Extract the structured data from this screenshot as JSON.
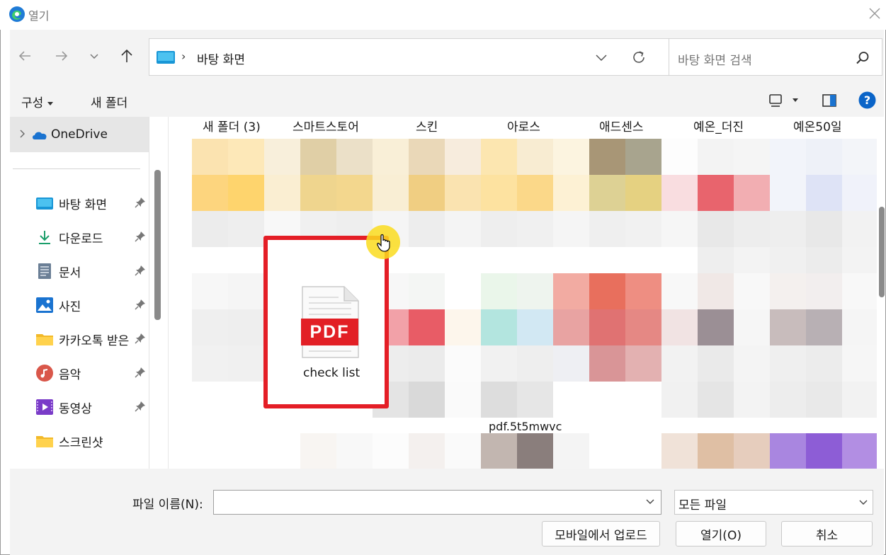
{
  "window": {
    "title": "열기"
  },
  "nav": {
    "address_path": "바탕 화면",
    "address_separator": "›",
    "search_placeholder": "바탕 화면 검색"
  },
  "commands": {
    "organize": "구성",
    "new_folder": "새 폴더"
  },
  "sidebar": {
    "onedrive": "OneDrive",
    "items": [
      {
        "label": "바탕 화면",
        "icon": "desktop-icon",
        "pinned": true
      },
      {
        "label": "다운로드",
        "icon": "download-icon",
        "pinned": true
      },
      {
        "label": "문서",
        "icon": "document-icon",
        "pinned": true
      },
      {
        "label": "사진",
        "icon": "pictures-icon",
        "pinned": true
      },
      {
        "label": "카카오톡 받은",
        "icon": "folder-icon",
        "pinned": true
      },
      {
        "label": "음악",
        "icon": "music-icon",
        "pinned": true
      },
      {
        "label": "동영상",
        "icon": "video-icon",
        "pinned": true
      },
      {
        "label": "스크린샷",
        "icon": "folder-icon",
        "pinned": false
      }
    ]
  },
  "content": {
    "column_labels": [
      "새 폴더 (3)",
      "스마트스토어",
      "스킨",
      "아로스",
      "애드센스",
      "예온_더진",
      "예온50일"
    ],
    "highlighted_file": {
      "type_badge": "PDF",
      "name": "check list"
    },
    "other_file_label": "pdf.5t5mwvc"
  },
  "footer": {
    "filename_label": "파일 이름(N):",
    "filename_value": "",
    "filetype_value": "모든 파일",
    "mobile_upload": "모바일에서 업로드",
    "open": "열기(O)",
    "cancel": "취소"
  },
  "colors": {
    "highlight_red": "#e41e26",
    "accent_blue": "#0a64c8",
    "cursor_glow": "#fadc1e"
  }
}
